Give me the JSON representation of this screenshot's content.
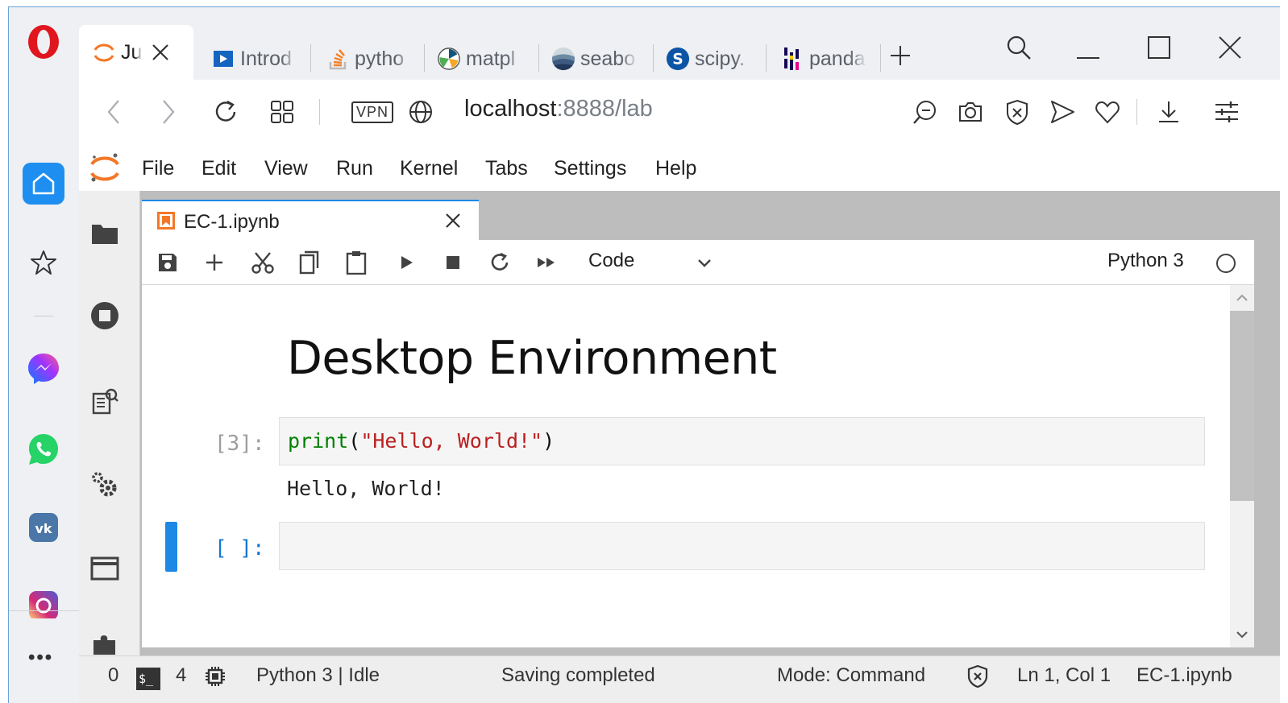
{
  "browser": {
    "tabs": [
      {
        "label": "Jupyter",
        "icon": "jupyter-icon"
      },
      {
        "label": "Introd",
        "icon": "video-icon"
      },
      {
        "label": "pytho",
        "icon": "stackoverflow-icon"
      },
      {
        "label": "matpl",
        "icon": "matplotlib-icon"
      },
      {
        "label": "seabo",
        "icon": "seaborn-icon"
      },
      {
        "label": "scipy.",
        "icon": "scipy-icon"
      },
      {
        "label": "panda",
        "icon": "pandas-icon"
      }
    ],
    "new_tab_label": "+",
    "vpn_label": "VPN",
    "url_host": "localhost",
    "url_rest": ":8888/lab"
  },
  "jupyter": {
    "menu": [
      "File",
      "Edit",
      "View",
      "Run",
      "Kernel",
      "Tabs",
      "Settings",
      "Help"
    ],
    "notebook_tab": "EC-1.ipynb",
    "cell_type": "Code",
    "kernel": "Python 3",
    "heading": "Desktop Environment",
    "cells": [
      {
        "prompt": "[3]:",
        "code_fn": "print",
        "code_open": "(",
        "code_str": "\"Hello, World!\"",
        "code_close": ")",
        "output": "Hello, World!"
      },
      {
        "prompt": "[ ]:",
        "code": ""
      }
    ]
  },
  "status": {
    "count_a": "0",
    "terminal_badge": "$_",
    "count_b": "4",
    "kernel_state": "Python 3 | Idle",
    "save_state": "Saving completed",
    "mode": "Mode: Command",
    "position": "Ln 1, Col 1",
    "file": "EC-1.ipynb"
  },
  "colors": {
    "accent": "#1e88e5",
    "opera_red": "#e0161e",
    "jupyter_orange": "#f37726"
  }
}
